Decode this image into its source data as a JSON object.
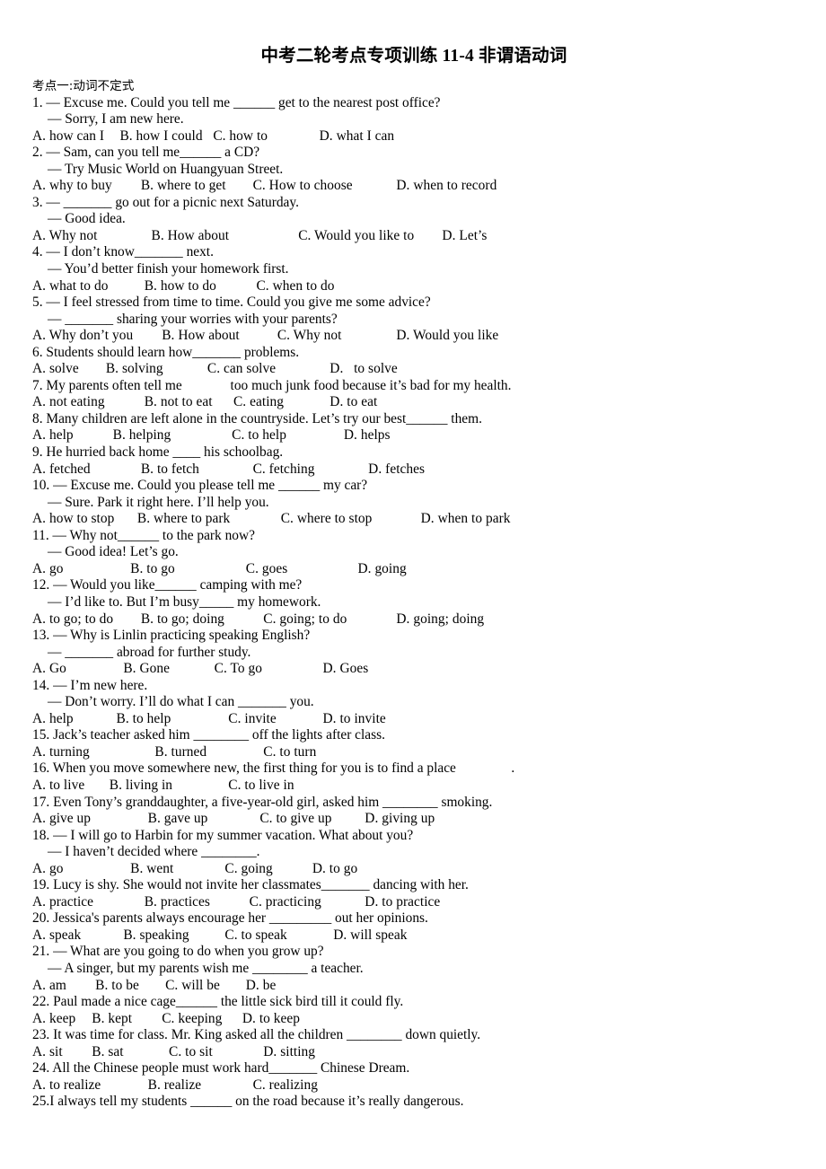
{
  "document": {
    "title": "中考二轮考点专项训练 11-4 非谓语动词",
    "section_heading": "考点一:动词不定式"
  },
  "lines": [
    {
      "type": "section",
      "text": "考点一:动词不定式"
    },
    {
      "type": "stem",
      "text": "1. — Excuse me. Could you tell me ______ get to the nearest post office?"
    },
    {
      "type": "reply",
      "text": "— Sorry, I am new here."
    },
    {
      "type": "options",
      "text": "A. how can I\t B. how I could   C. how to\t          D. what I can"
    },
    {
      "type": "stem",
      "text": "2. — Sam, can you tell me______ a CD?"
    },
    {
      "type": "reply",
      "text": "— Try Music World on Huangyuan Street."
    },
    {
      "type": "options",
      "text": "A. why to buy\t       B. where to get\t       C. How to choose\t        D. when to record"
    },
    {
      "type": "stem",
      "text": "3. — _______ go out for a picnic next Saturday."
    },
    {
      "type": "reply",
      "text": "— Good idea."
    },
    {
      "type": "options",
      "text": "A. Why not\t          B. How about\t            C. Would you like to        D. Let’s"
    },
    {
      "type": "stem",
      "text": "4. — I don’t know_______ next."
    },
    {
      "type": "reply",
      "text": "— You’d better finish your homework first."
    },
    {
      "type": "options",
      "text": "A. what to do\t        B. how to do\t        C. when to do"
    },
    {
      "type": "stem",
      "text": "5. — I feel stressed from time to time. Could you give me some advice?"
    },
    {
      "type": "reply",
      "text": "— _______ sharing your worries with your parents?"
    },
    {
      "type": "options",
      "text": "A. Why don’t you\t     B. How about\t      C. Why not\t        D. Would you like"
    },
    {
      "type": "stem",
      "text": "6. Students should learn how_______ problems."
    },
    {
      "type": "options",
      "text": "A. solve\t     B. solving\t          C. can solve\t             D.   to solve"
    },
    {
      "type": "stem",
      "text": "7. My parents often tell me              too much junk food because it’s bad for my health."
    },
    {
      "type": "options",
      "text": "A. not eating\t        B. not to eat      C. eating\t     D. to eat"
    },
    {
      "type": "stem",
      "text": "8. Many children are left alone in the countryside. Let’s try our best______ them."
    },
    {
      "type": "options",
      "text": "A. help\t       B. helping\t         C. to help\t         D. helps"
    },
    {
      "type": "stem",
      "text": "9. He hurried back home ____ his schoolbag."
    },
    {
      "type": "options",
      "text": "A. fetched\t       B. to fetch\t       C. fetching\t        D. fetches"
    },
    {
      "type": "stem",
      "text": "10. — Excuse me. Could you please tell me ______ my car?"
    },
    {
      "type": "reply",
      "text": "— Sure. Park it right here. I’ll help you."
    },
    {
      "type": "options",
      "text": "A. how to stop\t      B. where to park\t       C. where to stop\t       D. when to park"
    },
    {
      "type": "stem",
      "text": "11. — Why not______ to the park now?"
    },
    {
      "type": "reply",
      "text": "— Good idea! Let’s go."
    },
    {
      "type": "options",
      "text": "A. go\t            B. to go\t             C. goes\t             D. going"
    },
    {
      "type": "stem",
      "text": "12. — Would you like______ camping with me?"
    },
    {
      "type": "reply",
      "text": "— I’d like to. But I’m busy_____ my homework."
    },
    {
      "type": "options",
      "text": "A. to go; to do\t       B. to go; doing\t          C. going; to do\t        D. going; doing"
    },
    {
      "type": "stem",
      "text": "13. — Why is Linlin practicing speaking English?"
    },
    {
      "type": "reply",
      "text": "— _______ abroad for further study."
    },
    {
      "type": "options",
      "text": "A. Go\t          B. Gone\t            C. To go\t           D. Goes"
    },
    {
      "type": "stem",
      "text": "14. — I’m new here."
    },
    {
      "type": "reply",
      "text": "— Don’t worry. I’ll do what I can _______ you."
    },
    {
      "type": "options",
      "text": "A. help\t        B. to help\t        C. invite\t           D. to invite"
    },
    {
      "type": "stem",
      "text": "15. Jack’s teacher asked him ________ off the lights after class."
    },
    {
      "type": "options",
      "text": "A. turning\t           B. turned\t          C. to turn"
    },
    {
      "type": "stem",
      "text": "16. When you move somewhere new, the first thing for you is to find a place                ."
    },
    {
      "type": "options",
      "text": "A. to live\t      B. living in\t        C. to live in"
    },
    {
      "type": "stem",
      "text": "17. Even Tony’s granddaughter, a five-year-old girl, asked him ________ smoking."
    },
    {
      "type": "options",
      "text": "A. give up\t         B. gave up\t         C. to give up\t       D. giving up"
    },
    {
      "type": "stem",
      "text": "18. — I will go to Harbin for my summer vacation. What about you?"
    },
    {
      "type": "reply",
      "text": "— I haven’t decided where ________."
    },
    {
      "type": "options",
      "text": "A. go\t            B. went\t       C. going\t        D. to go"
    },
    {
      "type": "stem",
      "text": "19. Lucy is shy. She would not invite her classmates_______ dancing with her."
    },
    {
      "type": "options",
      "text": "A. practice\t        B. practices\t      C. practicing\t       D. to practice"
    },
    {
      "type": "stem",
      "text": "20. Jessica's parents always encourage her _________ out her opinions."
    },
    {
      "type": "options",
      "text": "A. speak\t          B. speaking\t       C. to speak\t      D. will speak"
    },
    {
      "type": "stem",
      "text": "21. — What are you going to do when you grow up?"
    },
    {
      "type": "reply",
      "text": "— A singer, but my parents wish me ________ a teacher."
    },
    {
      "type": "options",
      "text": "A. am\t  B. to be\t      C. will be\t     D. be"
    },
    {
      "type": "stem",
      "text": "22. Paul made a nice cage______ the little sick bird till it could fly."
    },
    {
      "type": "options",
      "text": "A. keep\t B. kept\t     C. keeping\t    D. to keep"
    },
    {
      "type": "stem",
      "text": "23. It was time for class. Mr. King asked all the children ________ down quietly."
    },
    {
      "type": "options",
      "text": "A. sit\t B. sat\t       C. to sit\t          D. sitting"
    },
    {
      "type": "stem",
      "text": "24. All the Chinese people must work hard_______ Chinese Dream."
    },
    {
      "type": "options",
      "text": "A. to realize\t         B. realize\t       C. realizing"
    },
    {
      "type": "stem",
      "text": "25.I always tell my students ______ on the road because it’s really dangerous."
    }
  ]
}
